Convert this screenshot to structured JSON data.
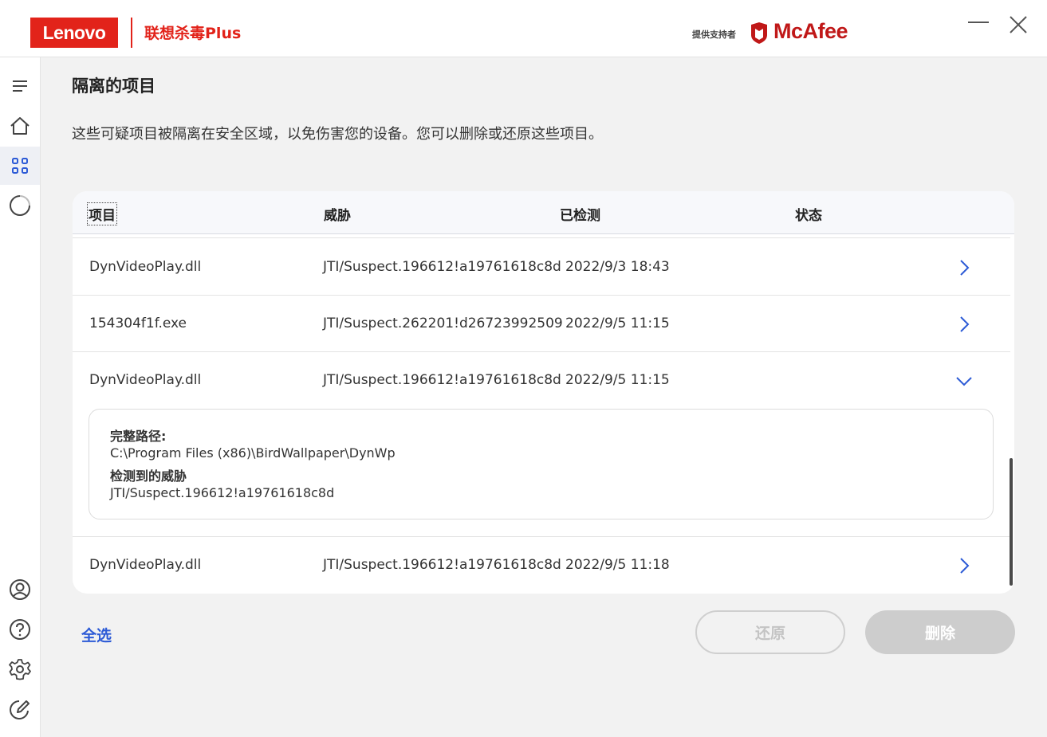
{
  "brand": {
    "lenovo_logo": "Lenovo",
    "product_name": "联想杀毒Plus",
    "powered_by": "提供支持者",
    "partner_logo": "McAfee",
    "colors": {
      "lenovo_red": "#e2231a",
      "mcafee_red": "#c01818",
      "accent_blue": "#2d5bd6"
    }
  },
  "window_controls": [
    "minimize-icon",
    "close-icon"
  ],
  "sidebar": {
    "items": [
      {
        "icon": "menu-icon"
      },
      {
        "icon": "home-icon"
      },
      {
        "icon": "apps-icon",
        "active": true
      },
      {
        "icon": "spinner-icon"
      },
      {
        "icon": "account-icon"
      },
      {
        "icon": "help-icon"
      },
      {
        "icon": "gear-icon"
      },
      {
        "icon": "feedback-icon"
      }
    ]
  },
  "page": {
    "title": "隔离的项目",
    "description": "这些可疑项目被隔离在安全区域，以免伤害您的设备。您可以删除或还原这些项目。"
  },
  "table": {
    "columns": [
      "项目",
      "威胁",
      "已检测",
      "状态"
    ],
    "rows": [
      {
        "item": "DynVideoPlay.dll",
        "threat": "JTI/Suspect.196612!a19761618c8d",
        "detected": "2022/9/3 18:43",
        "expanded": false
      },
      {
        "item": "154304f1f.exe",
        "threat": "JTI/Suspect.262201!d26723992509",
        "detected": "2022/9/5 11:15",
        "expanded": false
      },
      {
        "item": "DynVideoPlay.dll",
        "threat": "JTI/Suspect.196612!a19761618c8d",
        "detected": "2022/9/5 11:15",
        "expanded": true
      },
      {
        "item": "DynVideoPlay.dll",
        "threat": "JTI/Suspect.196612!a19761618c8d",
        "detected": "2022/9/5 11:18",
        "expanded": false
      }
    ],
    "details": {
      "path_label": "完整路径:",
      "path_value": "C:\\Program Files (x86)\\BirdWallpaper\\DynWp",
      "threat_label": "检测到的威胁",
      "threat_value": "JTI/Suspect.196612!a19761618c8d"
    }
  },
  "actions": {
    "select_all": "全选",
    "restore": "还原",
    "delete": "删除"
  }
}
